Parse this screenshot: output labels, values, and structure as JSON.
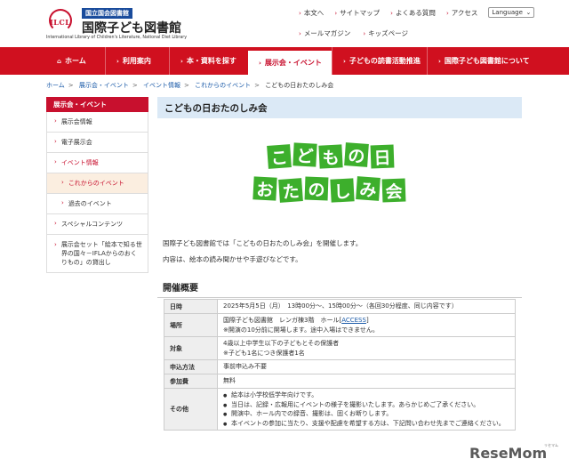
{
  "header": {
    "logo_letters": "ILCL",
    "logo_sub": "国立国会図書館",
    "logo_title": "国際子ども図書館",
    "logo_en": "International Library of Children's Literature, National Diet Library",
    "util_links": [
      "本文へ",
      "サイトマップ",
      "よくある質問",
      "アクセス"
    ],
    "language_label": "Language",
    "util_links2": [
      "メールマガジン",
      "キッズページ"
    ]
  },
  "nav": {
    "items": [
      {
        "label": "ホーム",
        "icon": "home-icon"
      },
      {
        "label": "利用案内",
        "icon": "chevron-right-icon"
      },
      {
        "label": "本・資料を探す",
        "icon": "chevron-right-icon"
      },
      {
        "label": "展示会・イベント",
        "icon": "chevron-right-icon"
      },
      {
        "label": "子どもの読書活動推進",
        "icon": "chevron-right-icon"
      },
      {
        "label": "国際子ども図書館について",
        "icon": "chevron-right-icon"
      }
    ],
    "active_index": 3
  },
  "breadcrumb": [
    "ホーム",
    "展示会・イベント",
    "イベント情報",
    "これからのイベント",
    "こどもの日おたのしみ会"
  ],
  "sidebar": {
    "header": "展示会・イベント",
    "items": [
      {
        "label": "展示会情報"
      },
      {
        "label": "電子展示会"
      },
      {
        "label": "イベント情報"
      },
      {
        "label": "これからのイベント"
      },
      {
        "label": "過去のイベント"
      },
      {
        "label": "スペシャルコンテンツ"
      },
      {
        "label": "展示会セット「絵本で知る世界の国々－IFLAからのおくりもの」の貸出し"
      }
    ]
  },
  "main": {
    "title": "こどもの日おたのしみ会",
    "hero_line1": [
      "こ",
      "ど",
      "も",
      "の",
      "日"
    ],
    "hero_line2": [
      "お",
      "た",
      "の",
      "し",
      "み",
      "会"
    ],
    "intro1": "国際子ども図書館では「こどもの日おたのしみ会」を開催します。",
    "intro2": "内容は、絵本の読み聞かせや手遊びなどです。",
    "section_heading": "開催概要"
  },
  "table": {
    "date_label": "日時",
    "date_value": "2025年5月5日（月）　13時00分～、15時00分～（各回30分程度、同じ内容です）",
    "place_label": "場所",
    "place_value_a": "国際子ども図書館　レンガ棟3階　ホール",
    "place_link": "ACCESS",
    "place_value_b": "※開演の10分前に開場します。途中入場はできません。",
    "target_label": "対象",
    "target_value_a": "4歳以上中学生以下の子どもとその保護者",
    "target_value_b": "※子ども1名につき保護者1名",
    "apply_label": "申込方法",
    "apply_value": "事前申込み不要",
    "fee_label": "参加費",
    "fee_value": "無料",
    "other_label": "その他",
    "other_items": [
      "絵本は小学校低学年向けです。",
      "当日は、記録・広報用にイベントの様子を撮影いたします。あらかじめご了承ください。",
      "開演中、ホール内での録音、撮影は、固くお断りします。",
      "本イベントの参加に当たり、支援や配慮を希望する方は、下記問い合わせ先までご連絡ください。"
    ]
  },
  "watermark": {
    "text": "ReseMom",
    "small": "リセマム"
  },
  "colors": {
    "brand_red": "#d0101f",
    "title_bg": "#dbe9f6",
    "hero_green": "#3daf2c",
    "link_blue": "#1a5aa8"
  }
}
